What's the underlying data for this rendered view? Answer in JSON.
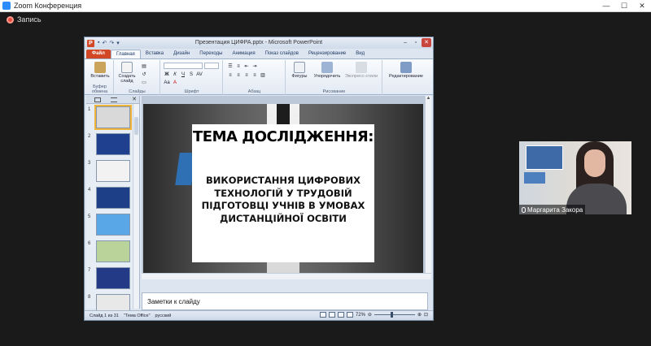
{
  "zoom": {
    "window_title": "Zoom Конференция",
    "controls": [
      "—",
      "☐",
      "✕"
    ],
    "recording_label": "Запись"
  },
  "ppt": {
    "doc_title": "Презентация ЦИФРА.pptx - Microsoft PowerPoint",
    "tabs": [
      "Файл",
      "Главная",
      "Вставка",
      "Дизайн",
      "Переходы",
      "Анимация",
      "Показ слайдов",
      "Рецензирование",
      "Вид"
    ],
    "active_tab": "Главная",
    "ribbon": {
      "clipboard_group": "Буфер обмена",
      "paste_label": "Вставить",
      "slides_group": "Слайды",
      "create_slide_label": "Создать слайд",
      "font_group": "Шрифт",
      "paragraph_group": "Абзац",
      "drawing_group": "Рисование",
      "shapes_label": "Фигуры",
      "arrange_label": "Упорядочить",
      "quick_styles_label": "Экспресс-стили",
      "editing_label": "Редактирование"
    },
    "thumbnails": [
      {
        "num": "1",
        "color": "#d9d9d9"
      },
      {
        "num": "2",
        "color": "#1f3f8f"
      },
      {
        "num": "3",
        "color": "#f2f2f2"
      },
      {
        "num": "4",
        "color": "#1c3f88"
      },
      {
        "num": "5",
        "color": "#5aa7e8"
      },
      {
        "num": "6",
        "color": "#b9d39a"
      },
      {
        "num": "7",
        "color": "#233a86"
      },
      {
        "num": "8",
        "color": "#e8e8e8"
      }
    ],
    "slide": {
      "heading": "ТЕМА ДОСЛІДЖЕННЯ:",
      "body": "ВИКОРИСТАННЯ ЦИФРОВИХ ТЕХНОЛОГІЙ У ТРУДОВІЙ ПІДГОТОВЦІ УЧНІВ В УМОВАХ ДИСТАНЦІЙНОЇ ОСВІТИ"
    },
    "notes_placeholder": "Заметки к слайду",
    "status": {
      "slide_info": "Слайд 1 из 31",
      "theme": "\"Тема Office\"",
      "language": "русский",
      "zoom": "72%"
    }
  },
  "participant": {
    "name": "Маргарита Закора"
  }
}
